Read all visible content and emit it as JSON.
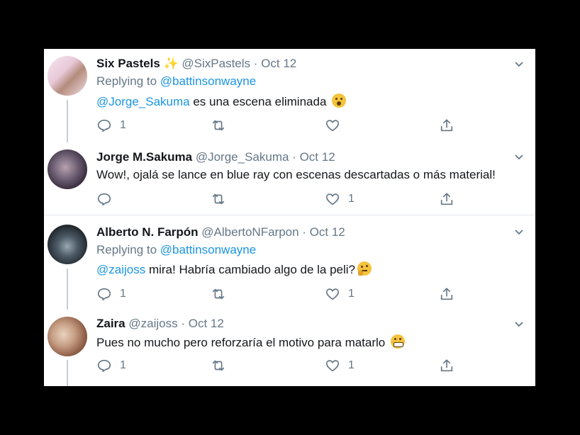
{
  "tweets": [
    {
      "name": "Six Pastels",
      "sparkle": "✨",
      "handle": "@SixPastels",
      "date": "· Oct 12",
      "replying_prefix": "Replying to",
      "replying_to": "@battinsonwayne",
      "mention": "@Jorge_Sakuma",
      "text": " es una escena eliminada",
      "emoji": "astonished-face",
      "reply_count": "1",
      "like_count": ""
    },
    {
      "name": "Jorge M.Sakuma",
      "handle": "@Jorge_Sakuma",
      "date": "· Oct 12",
      "text": "Wow!, ojalá se lance en blue ray con escenas descartadas o más material!",
      "reply_count": "",
      "like_count": "1"
    },
    {
      "name": "Alberto N. Farpón",
      "handle": "@AlbertoNFarpon",
      "date": "· Oct 12",
      "replying_prefix": "Replying to",
      "replying_to": "@battinsonwayne",
      "mention": "@zaijoss",
      "text": " mira! Habría cambiado algo de la peli?",
      "emoji": "thinking-face",
      "reply_count": "1",
      "like_count": "1"
    },
    {
      "name": "Zaira",
      "handle": "@zaijoss",
      "date": "· Oct 12",
      "text": "Pues no mucho pero reforzaría el motivo para matarlo ",
      "emoji": "grimacing-face",
      "reply_count": "1",
      "like_count": "1"
    }
  ],
  "colors": {
    "link": "#1b95e0",
    "secondary_text": "#657786",
    "primary_text": "#14171a",
    "divider": "#e1e8ed"
  },
  "icons": [
    "reply-icon",
    "retweet-icon",
    "like-icon",
    "share-icon",
    "chevron-down-icon"
  ]
}
